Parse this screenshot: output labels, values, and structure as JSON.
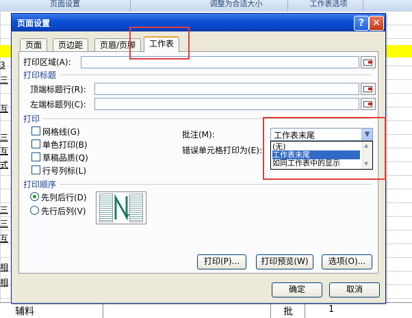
{
  "background": {
    "ribbon_groups": [
      "页面设置",
      "调整为合适大小",
      "工作表选项"
    ],
    "cell_fragments": [
      "3",
      "三",
      "互",
      "三",
      "互",
      "式",
      "三",
      "三",
      "互",
      "相",
      "相"
    ],
    "bottom_row": {
      "c1": "辅料",
      "c2": "批",
      "c3": "1"
    }
  },
  "dialog": {
    "title": "页面设置",
    "help_label": "?",
    "close_label": "✕",
    "tabs": [
      "页面",
      "页边距",
      "页眉/页脚",
      "工作表"
    ],
    "active_tab": "工作表",
    "print_area_label": "打印区域(A):",
    "print_titles_section": "打印标题",
    "top_rows_label": "顶端标题行(R):",
    "left_cols_label": "左端标题列(C):",
    "print_section": "打印",
    "checkboxes": [
      "网格线(G)",
      "单色打印(B)",
      "草稿品质(Q)",
      "行号列标(L)"
    ],
    "comments_label": "批注(M):",
    "comments_value": "工作表末尾",
    "cell_errors_label": "错误单元格打印为(E):",
    "dropdown_options": [
      "(无)",
      "工作表末尾",
      "如同工作表中的显示"
    ],
    "dropdown_selected_index": 1,
    "page_order_section": "打印顺序",
    "page_order_options": [
      "先列后行(D)",
      "先行后列(V)"
    ],
    "page_order_selected": 0,
    "print_button": "打印(P)...",
    "preview_button": "打印预览(W)",
    "options_button": "选项(O)...",
    "ok_button": "确定",
    "cancel_button": "取消"
  },
  "colors": {
    "title_bar": "#0a4fd2",
    "highlight_box": "#e23c3c",
    "selection": "#316ac5"
  }
}
